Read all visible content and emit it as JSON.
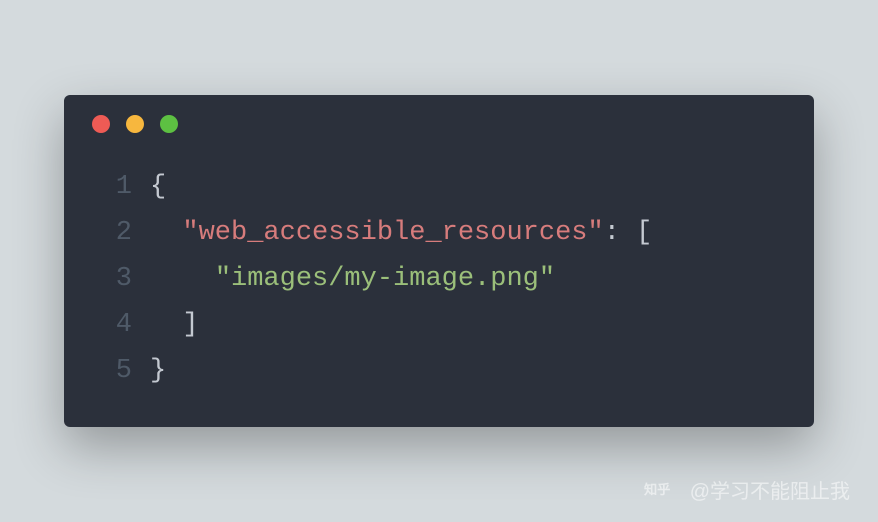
{
  "code": {
    "lines": [
      {
        "num": "1",
        "tokens": [
          {
            "t": "punc",
            "v": "{"
          }
        ]
      },
      {
        "num": "2",
        "tokens": [
          {
            "t": "punc",
            "v": "  "
          },
          {
            "t": "key",
            "v": "\"web_accessible_resources\""
          },
          {
            "t": "punc",
            "v": ": ["
          }
        ]
      },
      {
        "num": "3",
        "tokens": [
          {
            "t": "punc",
            "v": "    "
          },
          {
            "t": "string",
            "v": "\"images/my-image.png\""
          }
        ]
      },
      {
        "num": "4",
        "tokens": [
          {
            "t": "punc",
            "v": "  ]"
          }
        ]
      },
      {
        "num": "5",
        "tokens": [
          {
            "t": "punc",
            "v": "}"
          }
        ]
      }
    ]
  },
  "watermark": {
    "brand": "知乎",
    "author": "@学习不能阻止我"
  }
}
